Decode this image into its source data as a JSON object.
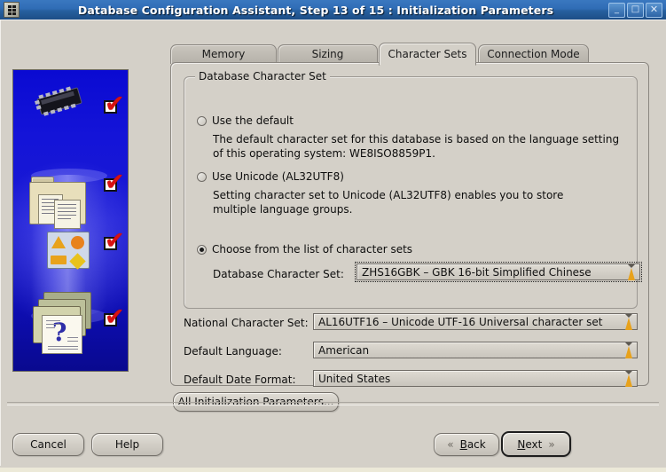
{
  "window": {
    "title": "Database Configuration Assistant, Step 13 of 15 : Initialization Parameters",
    "icon": "app-icon",
    "minimize_label": "_",
    "maximize_label": "□",
    "close_label": "✕"
  },
  "tabs": [
    {
      "label": "Memory",
      "active": false
    },
    {
      "label": "Sizing",
      "active": false
    },
    {
      "label": "Character Sets",
      "active": true
    },
    {
      "label": "Connection Mode",
      "active": false
    }
  ],
  "group": {
    "title": "Database Character Set",
    "options": [
      {
        "label": "Use the default",
        "selected": false,
        "description": "The default character set for this database is based on the language setting of this operating system: WE8ISO8859P1."
      },
      {
        "label": "Use Unicode (AL32UTF8)",
        "selected": false,
        "description": "Setting character set to Unicode (AL32UTF8) enables you to store multiple language groups."
      },
      {
        "label": "Choose from the list of character sets",
        "selected": true,
        "description": ""
      }
    ],
    "db_charset": {
      "label": "Database Character Set:",
      "value": "ZHS16GBK – GBK 16-bit Simplified Chinese"
    }
  },
  "fields": [
    {
      "label": "National Character Set:",
      "value": "AL16UTF16 – Unicode UTF-16 Universal character set"
    },
    {
      "label": "Default Language:",
      "value": "American"
    },
    {
      "label": "Default Date Format:",
      "value": "United States"
    }
  ],
  "buttons": {
    "all_params": "All Initialization Parameters...",
    "cancel": "Cancel",
    "help": "Help",
    "back": "Back",
    "next": "Next",
    "back_chevron": "«",
    "next_chevron": "»"
  },
  "sidebar": {
    "steps": [
      {
        "icon": "chip-icon",
        "checked": true
      },
      {
        "icon": "folder-documents-icon",
        "checked": true
      },
      {
        "icon": "shapes-panel-icon",
        "checked": true
      },
      {
        "icon": "folders-question-icon",
        "checked": true
      }
    ],
    "check_glyph": "✔"
  },
  "colors": {
    "titlebar": "#2f6cb5",
    "dialog_face": "#d4d0c8",
    "artwork_blue": "#1414d8",
    "check_red": "#d81111"
  }
}
